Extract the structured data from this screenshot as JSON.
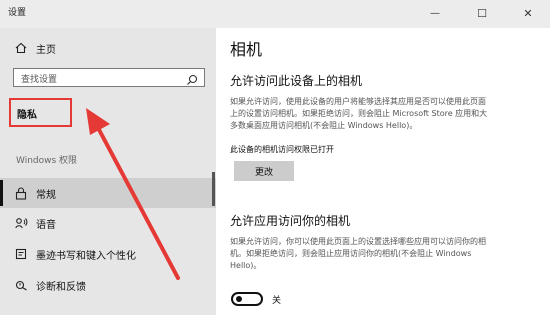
{
  "window": {
    "title": "设置",
    "controls": {
      "minimize": "—",
      "maximize": "☐",
      "close": "✕"
    }
  },
  "sidebar": {
    "home_label": "主页",
    "search_placeholder": "查找设置",
    "privacy_label": "隐私",
    "section_title": "Windows 权限",
    "items": [
      {
        "label": "常规",
        "icon": "lock-icon"
      },
      {
        "label": "语音",
        "icon": "voice-icon"
      },
      {
        "label": "墨迹书写和键入个性化",
        "icon": "inking-icon"
      },
      {
        "label": "诊断和反馈",
        "icon": "diagnostics-icon"
      }
    ]
  },
  "main": {
    "page_title": "相机",
    "section1": {
      "heading": "允许访问此设备上的相机",
      "desc_lines": [
        "如果允许访问，使用此设备的用户将能够选择其应用是否可以使用此页面",
        "上的设置访问相机。如果拒绝访问，则会阻止 Microsoft Store 应用和大",
        "多数桌面应用访问相机(不会阻止 Windows Hello)。"
      ],
      "status": "此设备的相机访问权限已打开",
      "change_button": "更改"
    },
    "section2": {
      "heading": "允许应用访问你的相机",
      "desc_lines": [
        "如果允许访问，你可以使用此页面上的设置选择哪些应用可以访问你的相",
        "机。如果拒绝访问，则会阻止应用访问你的相机(不会阻止 Windows",
        "Hello)。"
      ],
      "toggle_label": "关"
    }
  },
  "colors": {
    "highlight": "#e53935",
    "sidebar_bg": "#e6e6e6",
    "selected_bg": "#cfcfcf"
  }
}
